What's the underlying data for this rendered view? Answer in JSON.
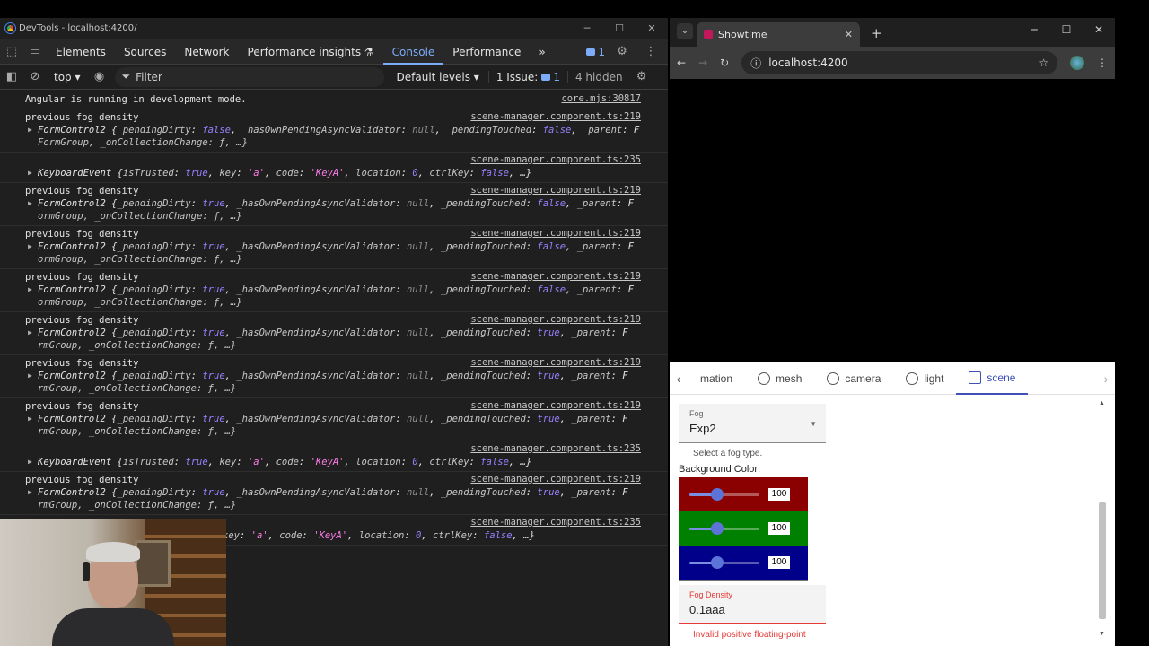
{
  "devtools": {
    "window_title": "DevTools - localhost:4200/",
    "tabs": [
      "Elements",
      "Sources",
      "Network",
      "Performance insights ⚗",
      "Console",
      "Performance"
    ],
    "active_tab": "Console",
    "more_tabs": "»",
    "issue_badge_count": "1",
    "toolbar": {
      "context": "top ▾",
      "filter_placeholder": "Filter",
      "levels": "Default levels ▾",
      "issues_label": "1 Issue:",
      "issues_count": "1",
      "hidden": "4 hidden"
    },
    "messages": [
      {
        "type": "plain",
        "text": "Angular is running in development mode.",
        "src": "core.mjs:30817"
      },
      {
        "type": "fc",
        "head": "previous fog density",
        "src": "scene-manager.component.ts:219",
        "dirty": "false",
        "touched": "false",
        "cont": "FormGroup, _onCollectionChange: ƒ, …}"
      },
      {
        "type": "ke",
        "src": "scene-manager.component.ts:235"
      },
      {
        "type": "fc",
        "head": "previous fog density",
        "src": "scene-manager.component.ts:219",
        "dirty": "true",
        "touched": "false",
        "cont": "ormGroup, _onCollectionChange: ƒ, …}"
      },
      {
        "type": "fc",
        "head": "previous fog density",
        "src": "scene-manager.component.ts:219",
        "dirty": "true",
        "touched": "false",
        "cont": "ormGroup, _onCollectionChange: ƒ, …}"
      },
      {
        "type": "fc",
        "head": "previous fog density",
        "src": "scene-manager.component.ts:219",
        "dirty": "true",
        "touched": "false",
        "cont": "ormGroup, _onCollectionChange: ƒ, …}"
      },
      {
        "type": "fc",
        "head": "previous fog density",
        "src": "scene-manager.component.ts:219",
        "dirty": "true",
        "touched": "true",
        "cont": "rmGroup, _onCollectionChange: ƒ, …}"
      },
      {
        "type": "fc",
        "head": "previous fog density",
        "src": "scene-manager.component.ts:219",
        "dirty": "true",
        "touched": "true",
        "cont": "rmGroup, _onCollectionChange: ƒ, …}"
      },
      {
        "type": "fc",
        "head": "previous fog density",
        "src": "scene-manager.component.ts:219",
        "dirty": "true",
        "touched": "true",
        "cont": "rmGroup, _onCollectionChange: ƒ, …}"
      },
      {
        "type": "ke",
        "src": "scene-manager.component.ts:235"
      },
      {
        "type": "fc",
        "head": "previous fog density",
        "src": "scene-manager.component.ts:219",
        "dirty": "true",
        "touched": "true",
        "cont": "rmGroup, _onCollectionChange: ƒ, …}"
      },
      {
        "type": "ke_partial",
        "src": "scene-manager.component.ts:235"
      }
    ],
    "fc_name": "FormControl2",
    "ke_name": "KeyboardEvent"
  },
  "browser": {
    "tab_title": "Showtime",
    "url": "localhost:4200",
    "app": {
      "tabs": [
        {
          "label": "mation",
          "icon": "",
          "active": false
        },
        {
          "label": "mesh",
          "icon": "mesh-icon",
          "active": false
        },
        {
          "label": "camera",
          "icon": "camera-icon",
          "active": false
        },
        {
          "label": "light",
          "icon": "light-icon",
          "active": false
        },
        {
          "label": "scene",
          "icon": "scene-icon",
          "active": true
        }
      ],
      "fog": {
        "label": "Fog",
        "value": "Exp2",
        "hint": "Select a fog type."
      },
      "background_color": {
        "label": "Background Color:",
        "red": "100",
        "green": "100",
        "blue": "100",
        "colors": {
          "red": "#8b0000",
          "green": "#008000",
          "blue": "#00008b"
        }
      },
      "fog_density": {
        "label": "Fog Density",
        "value": "0.1aaa",
        "error": "Invalid positive floating-point"
      }
    }
  }
}
